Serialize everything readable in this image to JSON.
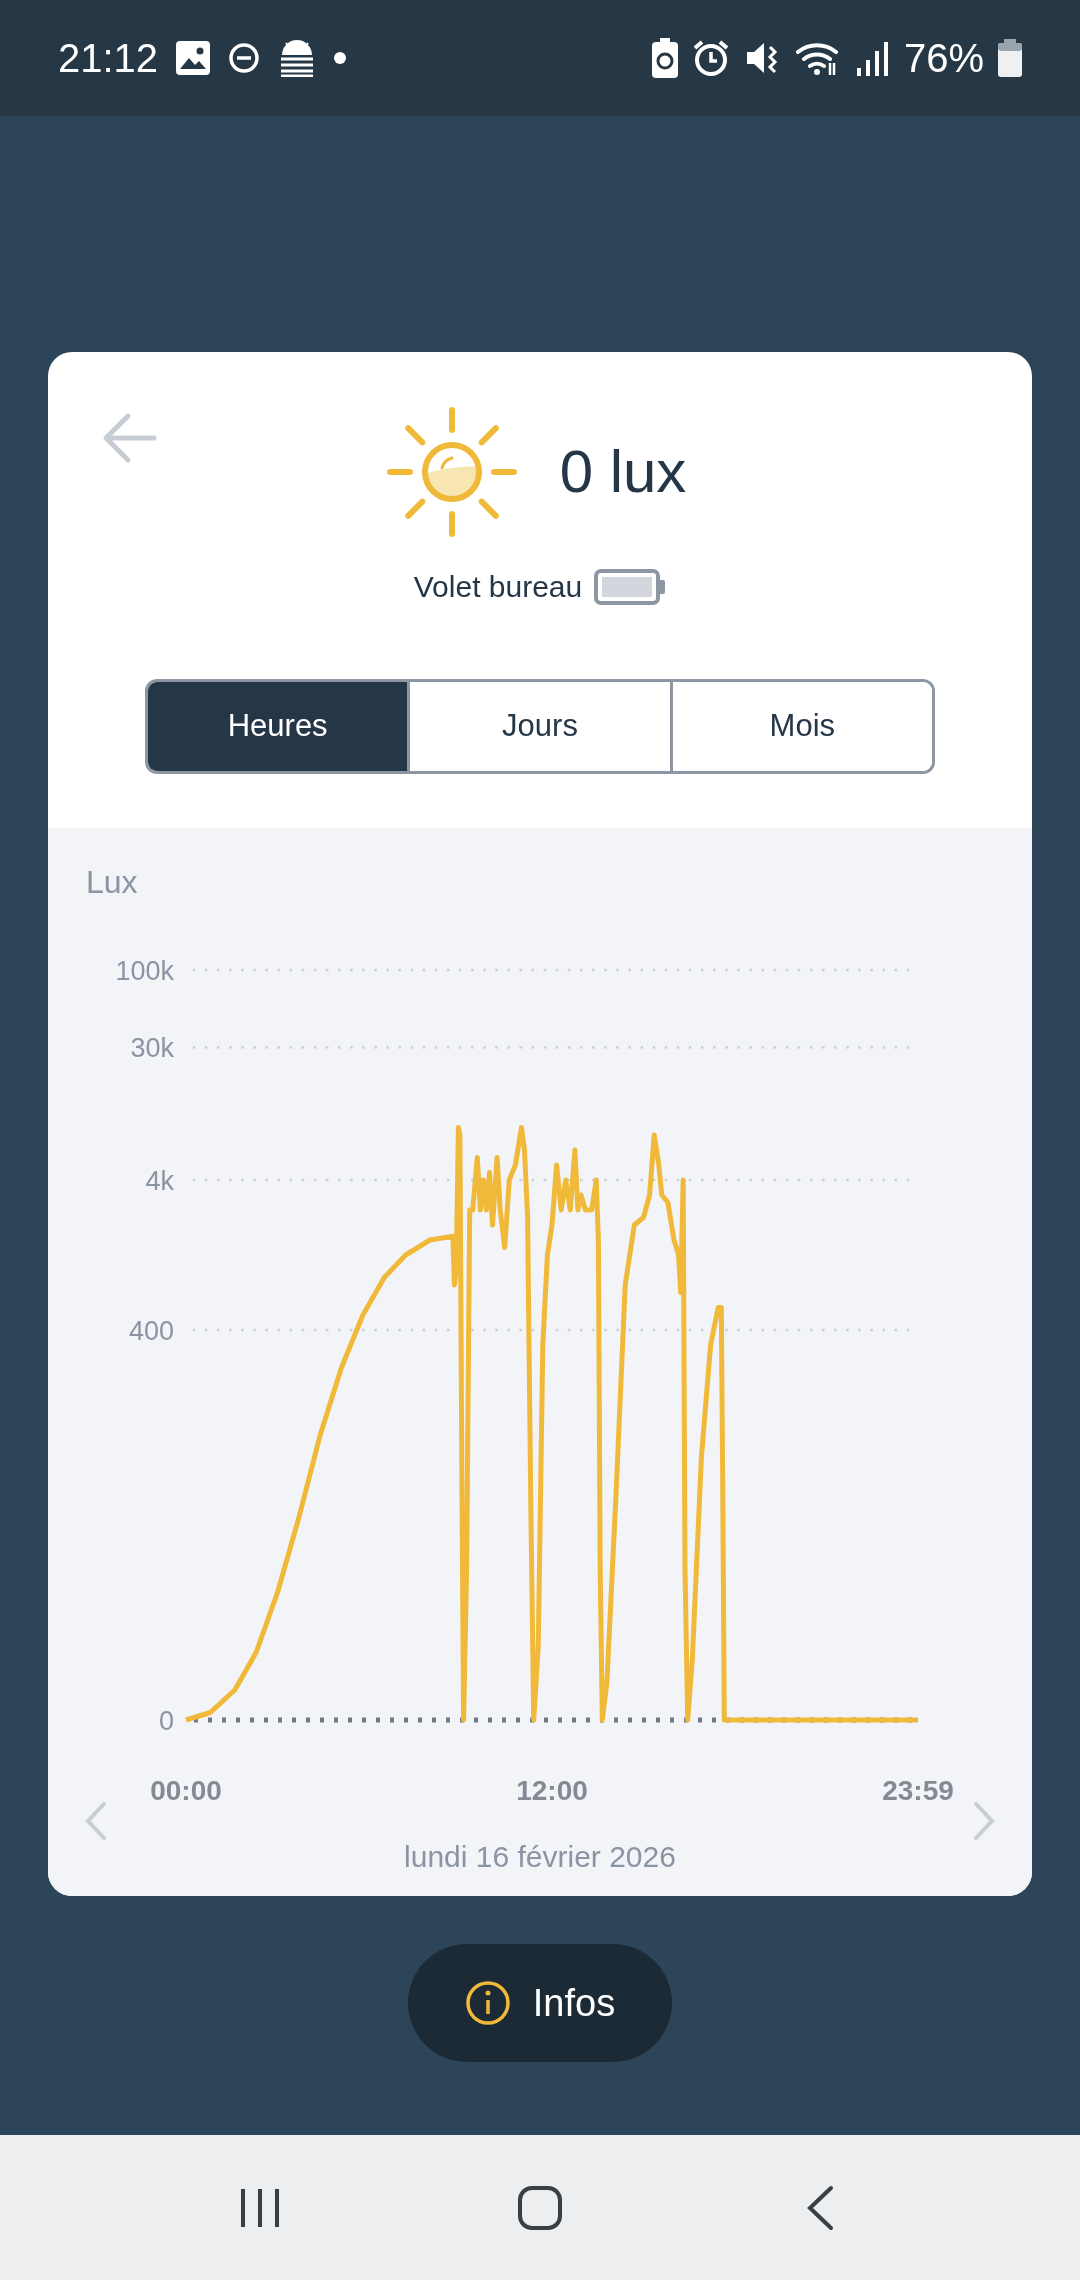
{
  "status_bar": {
    "time": "21:12",
    "battery": "76%"
  },
  "header": {
    "reading": "0 lux",
    "device": "Volet bureau"
  },
  "tabs": [
    {
      "label": "Heures",
      "selected": true
    },
    {
      "label": "Jours",
      "selected": false
    },
    {
      "label": "Mois",
      "selected": false
    }
  ],
  "chart": {
    "title": "Lux",
    "y_labels": [
      "100k",
      "30k",
      "4k",
      "400",
      "0"
    ],
    "x_labels": [
      "00:00",
      "12:00",
      "23:59"
    ],
    "date": "lundi 16 février 2026"
  },
  "info_button": {
    "label": "Infos"
  }
}
